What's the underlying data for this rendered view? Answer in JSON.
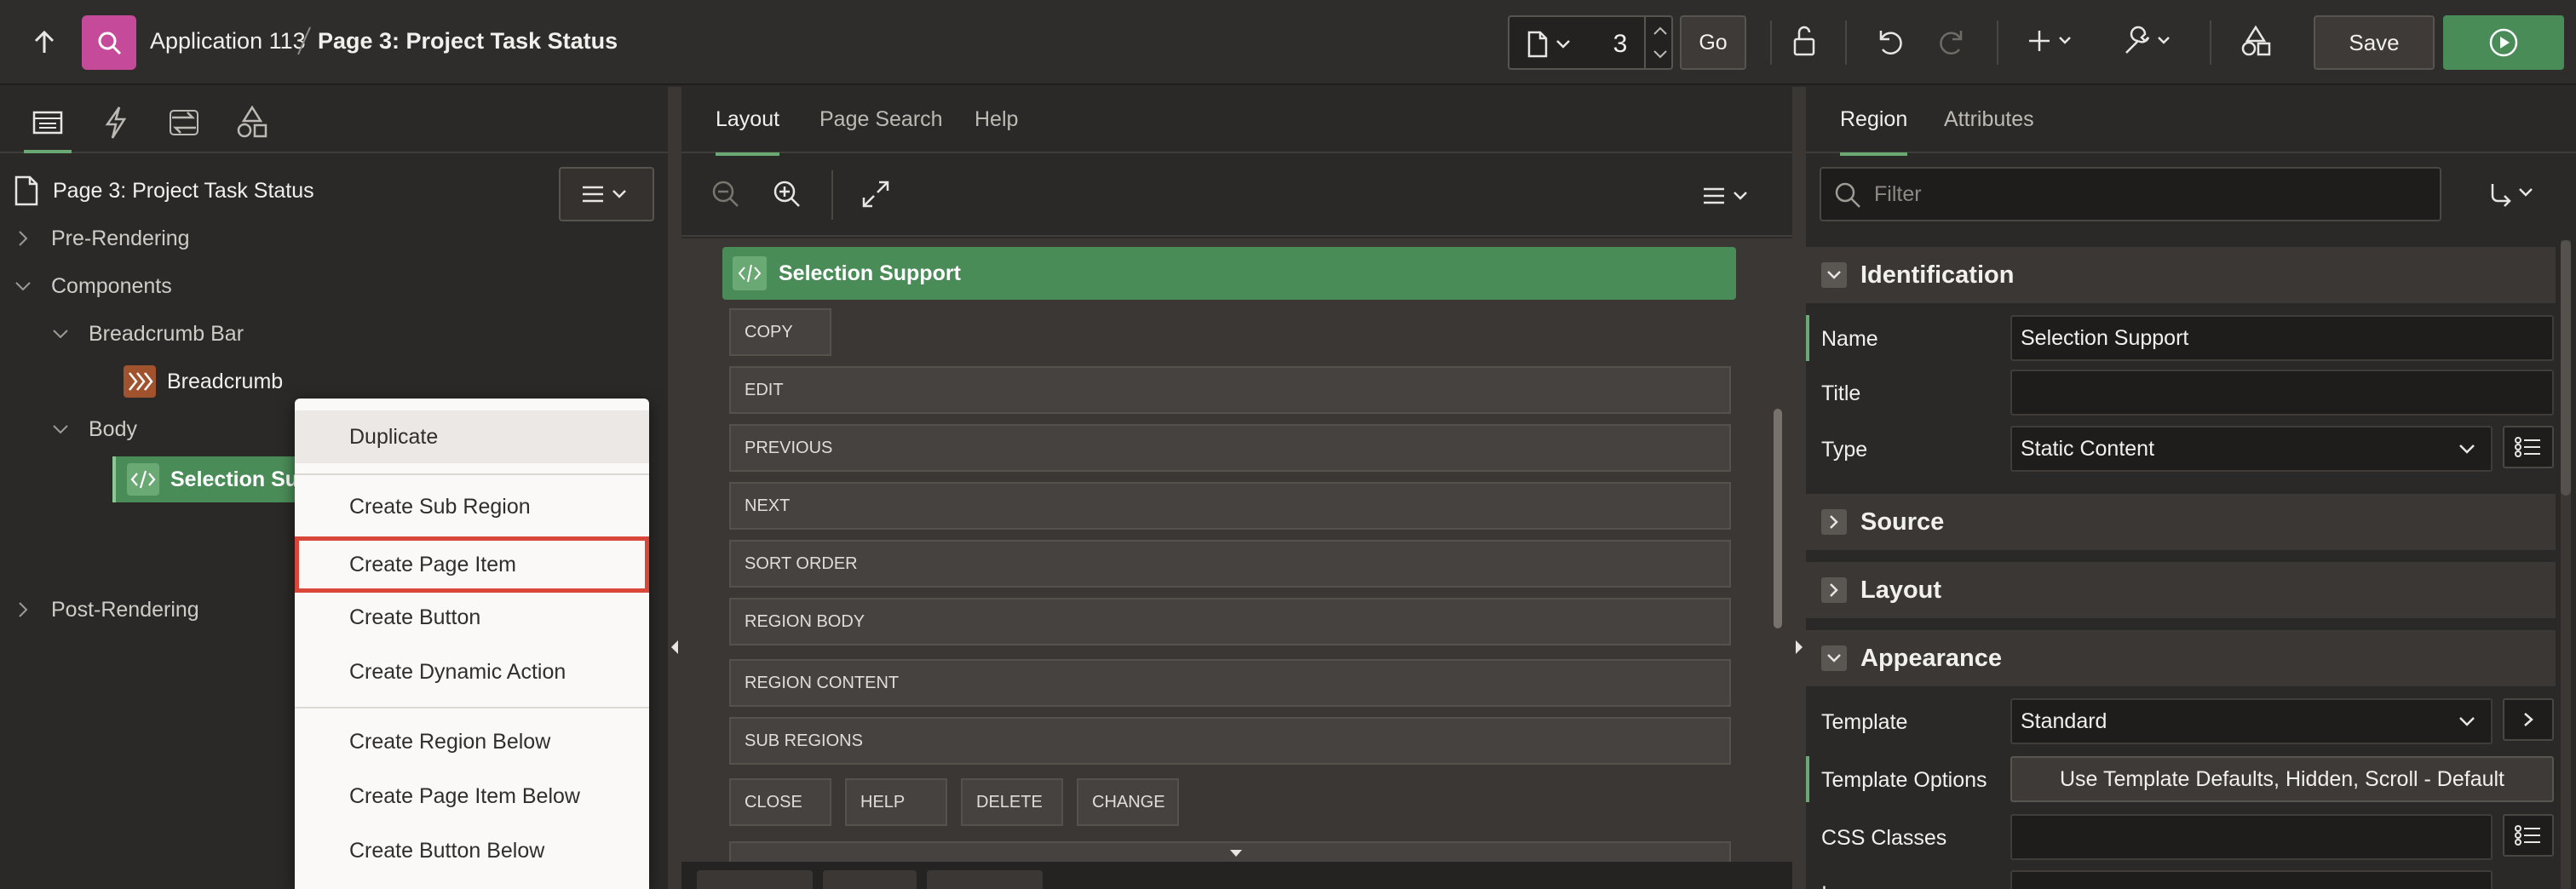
{
  "topbar": {
    "app_name": "Application 113",
    "page_name": "Page 3: Project Task Status",
    "page_number": "3",
    "go_label": "Go",
    "save_label": "Save"
  },
  "tree": {
    "root": "Page 3: Project Task Status",
    "nodes": {
      "pre_rendering": "Pre-Rendering",
      "components": "Components",
      "breadcrumb_bar": "Breadcrumb Bar",
      "breadcrumb": "Breadcrumb",
      "body": "Body",
      "selection_support": "Selection Support",
      "post_rendering": "Post-Rendering"
    }
  },
  "context_menu": {
    "items": [
      "Duplicate",
      "Create Sub Region",
      "Create Page Item",
      "Create Button",
      "Create Dynamic Action",
      "Create Region Below",
      "Create Page Item Below",
      "Create Button Below"
    ],
    "hovered": "Duplicate",
    "focused": "Create Page Item"
  },
  "center": {
    "tabs": [
      "Layout",
      "Page Search",
      "Help"
    ],
    "active_tab": "Layout",
    "region_title": "Selection Support",
    "slots": {
      "copy": "COPY",
      "edit": "EDIT",
      "previous": "PREVIOUS",
      "next": "NEXT",
      "sort_order": "SORT ORDER",
      "region_body": "REGION BODY",
      "region_content": "REGION CONTENT",
      "sub_regions": "SUB REGIONS",
      "close": "CLOSE",
      "help": "HELP",
      "delete": "DELETE",
      "change": "CHANGE"
    }
  },
  "right": {
    "tabs": [
      "Region",
      "Attributes"
    ],
    "active_tab": "Region",
    "filter_placeholder": "Filter",
    "groups": {
      "identification": "Identification",
      "source": "Source",
      "layout": "Layout",
      "appearance": "Appearance"
    },
    "props": {
      "name_label": "Name",
      "name_value": "Selection Support",
      "title_label": "Title",
      "title_value": "",
      "type_label": "Type",
      "type_value": "Static Content",
      "template_label": "Template",
      "template_value": "Standard",
      "template_options_label": "Template Options",
      "template_options_value": "Use Template Defaults, Hidden, Scroll - Default",
      "css_classes_label": "CSS Classes",
      "icon_label": "Icon"
    }
  },
  "colors": {
    "accent_green": "#4a8c58",
    "app_icon": "#c54a99",
    "focus_outline": "#d9473a"
  },
  "icons": [
    "arrow-up-icon",
    "search-icon",
    "page-icon",
    "lock-icon",
    "undo-icon",
    "redo-icon",
    "plus-icon",
    "wrench-icon",
    "shapes-icon",
    "play-icon",
    "rendering-icon",
    "lightning-icon",
    "processing-icon",
    "shared-components-icon",
    "zoom-out-icon",
    "zoom-in-icon",
    "expand-icon",
    "menu-icon",
    "code-icon",
    "breadcrumb-icon",
    "go-to-icon"
  ]
}
